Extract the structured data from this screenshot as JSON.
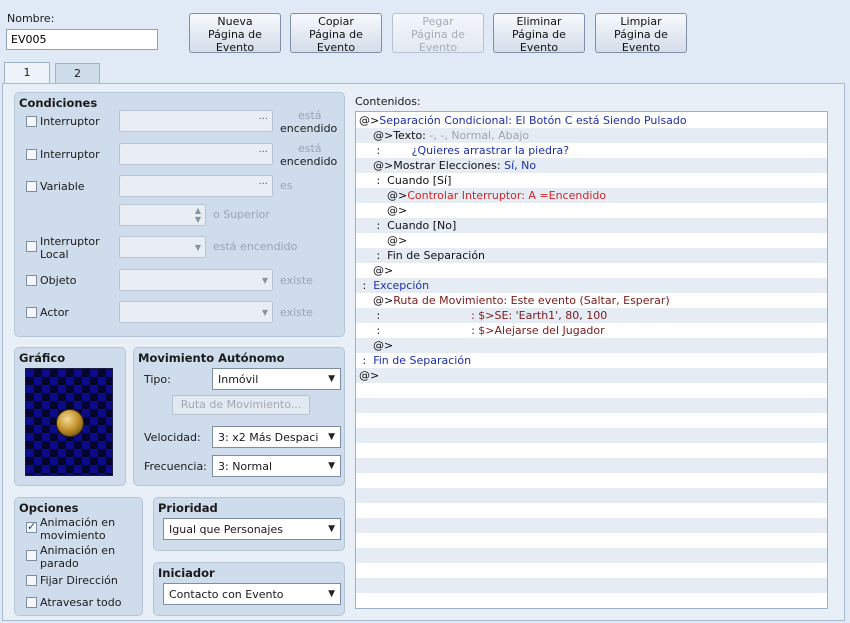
{
  "name": {
    "label": "Nombre:",
    "value": "EV005"
  },
  "toolbar": [
    {
      "id": "new",
      "lines": [
        "Nueva",
        "Página de",
        "Evento"
      ],
      "enabled": true
    },
    {
      "id": "copy",
      "lines": [
        "Copiar",
        "Página de",
        "Evento"
      ],
      "enabled": true
    },
    {
      "id": "paste",
      "lines": [
        "Pegar",
        "Página de",
        "Evento"
      ],
      "enabled": false
    },
    {
      "id": "delete",
      "lines": [
        "Eliminar",
        "Página de",
        "Evento"
      ],
      "enabled": true
    },
    {
      "id": "clear",
      "lines": [
        "Limpiar",
        "Página de",
        "Evento"
      ],
      "enabled": true
    }
  ],
  "tabs": [
    "1",
    "2"
  ],
  "conditions": {
    "title": "Condiciones",
    "switch1": {
      "label": "Interruptor",
      "suffix1": "está",
      "suffix2": "encendido"
    },
    "switch2": {
      "label": "Interruptor",
      "suffix1": "está",
      "suffix2": "encendido"
    },
    "variable": {
      "label": "Variable",
      "suffix": "es",
      "suffix_value": "o Superior"
    },
    "self_switch": {
      "label1": "Interruptor",
      "label2": "Local",
      "suffix": "está encendido"
    },
    "item": {
      "label": "Objeto",
      "suffix": "existe"
    },
    "actor": {
      "label": "Actor",
      "suffix": "existe"
    }
  },
  "graphic": {
    "title": "Gráfico"
  },
  "autonomous": {
    "title": "Movimiento Autónomo",
    "type_label": "Tipo:",
    "type_value": "Inmóvil",
    "route_button": "Ruta de Movimiento...",
    "speed_label": "Velocidad:",
    "speed_value": "3: x2 Más Despaci",
    "freq_label": "Frecuencia:",
    "freq_value": "3: Normal"
  },
  "options": {
    "title": "Opciones",
    "walking": {
      "line1": "Animación en",
      "line2": "movimiento",
      "checked": true
    },
    "stepping": {
      "line1": "Animación en",
      "line2": "parado",
      "checked": false
    },
    "direction_fix": {
      "label": "Fijar Dirección",
      "checked": false
    },
    "through": {
      "label": "Atravesar todo",
      "checked": false
    }
  },
  "priority": {
    "title": "Prioridad",
    "value": "Igual que Personajes"
  },
  "trigger": {
    "title": "Iniciador",
    "value": "Contacto con Evento"
  },
  "contents": {
    "label": "Contenidos:",
    "lines": [
      [
        {
          "t": "@>",
          "c": "black"
        },
        {
          "t": "Separación Condicional: El Botón C está Siendo Pulsado",
          "c": "blue"
        }
      ],
      [
        {
          "t": "    @>Texto: ",
          "c": "black"
        },
        {
          "t": "-, -, Normal, Abajo",
          "c": "gray"
        }
      ],
      [
        {
          "t": "     :         ",
          "c": "black"
        },
        {
          "t": "¿Quieres arrastrar la piedra?",
          "c": "blue"
        }
      ],
      [
        {
          "t": "    @>Mostrar Elecciones: ",
          "c": "black"
        },
        {
          "t": "Sí, No",
          "c": "blue"
        }
      ],
      [
        {
          "t": "     :  Cuando [Sí]",
          "c": "black"
        }
      ],
      [
        {
          "t": "        @>",
          "c": "black"
        },
        {
          "t": "Controlar Interruptor: A =Encendido",
          "c": "red"
        }
      ],
      [
        {
          "t": "        @>",
          "c": "black"
        }
      ],
      [
        {
          "t": "     :  Cuando [No]",
          "c": "black"
        }
      ],
      [
        {
          "t": "        @>",
          "c": "black"
        }
      ],
      [
        {
          "t": "     :  Fin de Separación",
          "c": "black"
        }
      ],
      [
        {
          "t": "    @>",
          "c": "black"
        }
      ],
      [
        {
          "t": " :  ",
          "c": "black"
        },
        {
          "t": "Excepción",
          "c": "blue"
        }
      ],
      [
        {
          "t": "    @>",
          "c": "black"
        },
        {
          "t": "Ruta de Movimiento: Este evento (Saltar, Esperar)",
          "c": "dark"
        }
      ],
      [
        {
          "t": "     :                          ",
          "c": "black"
        },
        {
          "t": ": $>SE: 'Earth1', 80, 100",
          "c": "dark"
        }
      ],
      [
        {
          "t": "     :                          ",
          "c": "black"
        },
        {
          "t": ": $>Alejarse del Jugador",
          "c": "dark"
        }
      ],
      [
        {
          "t": "    @>",
          "c": "black"
        }
      ],
      [
        {
          "t": " :  ",
          "c": "black"
        },
        {
          "t": "Fin de Separación",
          "c": "blue"
        }
      ],
      [
        {
          "t": "@>",
          "c": "black"
        }
      ]
    ]
  },
  "colors": {
    "accent_blue": "#1c2fa6",
    "accent_red": "#d42525",
    "panel_bg": "#cfdceb"
  }
}
